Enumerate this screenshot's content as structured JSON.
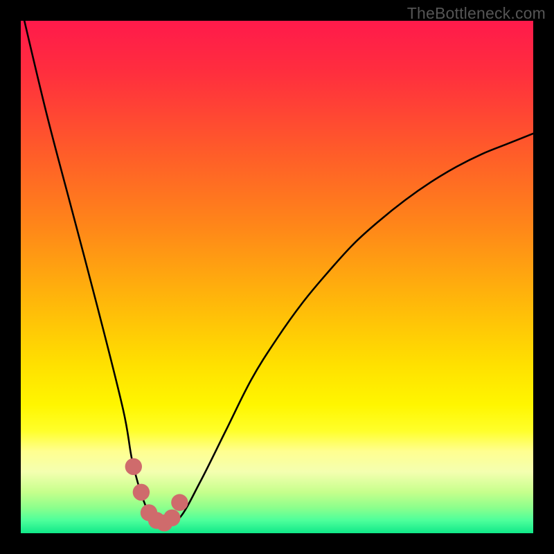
{
  "watermark": "TheBottleneck.com",
  "colors": {
    "frame": "#000000",
    "curve": "#000000",
    "marker": "#cf6b6c",
    "gradient_stops": [
      {
        "offset": 0.0,
        "color": "#ff1a4b"
      },
      {
        "offset": 0.1,
        "color": "#ff2e3e"
      },
      {
        "offset": 0.25,
        "color": "#ff5a2a"
      },
      {
        "offset": 0.4,
        "color": "#ff8619"
      },
      {
        "offset": 0.55,
        "color": "#ffb80a"
      },
      {
        "offset": 0.67,
        "color": "#ffe000"
      },
      {
        "offset": 0.75,
        "color": "#fff600"
      },
      {
        "offset": 0.8,
        "color": "#ffff2a"
      },
      {
        "offset": 0.84,
        "color": "#ffff90"
      },
      {
        "offset": 0.88,
        "color": "#f4ffb0"
      },
      {
        "offset": 0.92,
        "color": "#c6ff8c"
      },
      {
        "offset": 0.95,
        "color": "#8cff8c"
      },
      {
        "offset": 0.975,
        "color": "#4dff9b"
      },
      {
        "offset": 1.0,
        "color": "#10e889"
      }
    ]
  },
  "chart_data": {
    "type": "line",
    "title": "",
    "xlabel": "",
    "ylabel": "",
    "xlim": [
      0,
      100
    ],
    "ylim": [
      0,
      100
    ],
    "series": [
      {
        "name": "bottleneck-curve",
        "x": [
          0,
          5,
          10,
          15,
          20,
          22,
          25,
          28,
          31,
          35,
          40,
          45,
          50,
          55,
          60,
          65,
          70,
          75,
          80,
          85,
          90,
          95,
          100
        ],
        "y": [
          103,
          82,
          63,
          44,
          24,
          13,
          4,
          2,
          3,
          10,
          20,
          30,
          38,
          45,
          51,
          56.5,
          61,
          65,
          68.5,
          71.5,
          74,
          76,
          78
        ]
      }
    ],
    "markers": {
      "name": "highlight-dots",
      "x": [
        22.0,
        23.5,
        25.0,
        26.5,
        28.0,
        29.5,
        31.0
      ],
      "y": [
        13.0,
        8.0,
        4.0,
        2.5,
        2.0,
        3.0,
        6.0
      ]
    }
  }
}
